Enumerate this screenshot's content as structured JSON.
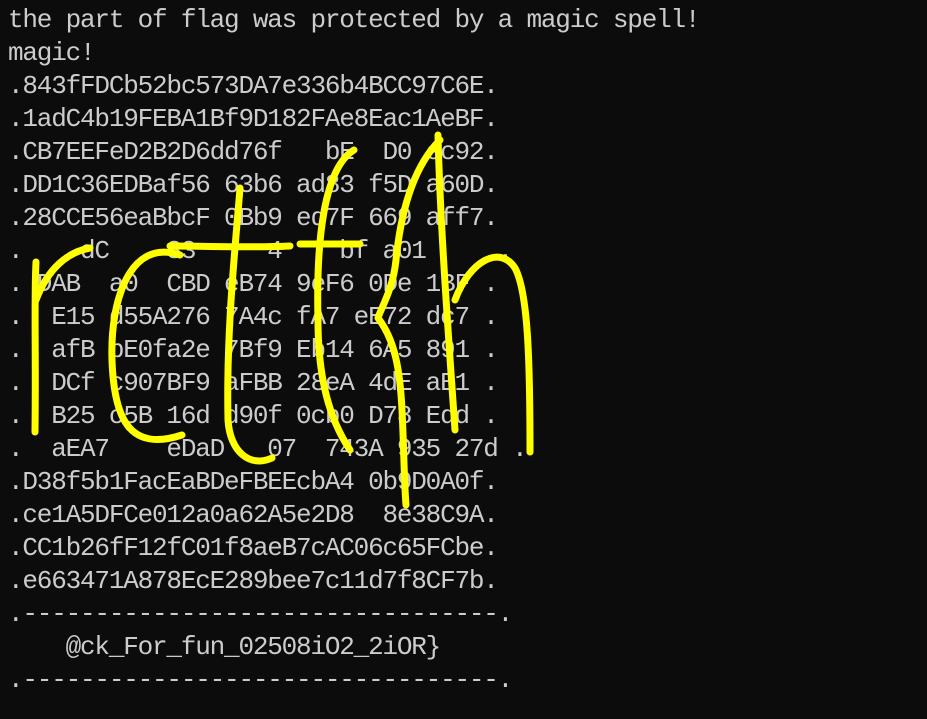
{
  "terminal": {
    "lines": [
      "the part of flag was protected by a magic spell!",
      "magic!",
      ".843fFDCb52bc573DA7e336b4BCC97C6E.",
      ".1adC4b19FEBA1Bf9D182FAe8Eac1AeBF.",
      ".CB7EEFeD2B2D6dd76f   bE  D0 ec92.",
      ".DD1C36EDBaf56 63b6 ad83 f5D a60D.",
      ".28CCE56eaBbcF 0Bb9 ed7F 669 aff7.",
      ".    dC    83     4    bf a01     .",
      ". DAB  a0  CBD eB74 9eF6 0De 1BF .",
      ".  E15 d55A276 7A4c fA7 eE72 dc7 .",
      ".  afB bE0fa2e 7Bf9 Eb14 6A5 891 .",
      ".  DCf c907BF9 aFBB 28eA 4dE aB1 .",
      ".  B25 c5B 16d d90f 0cb0 D78 Edd .",
      ".  aEA7    eDaD   07  743A 935 27d .",
      ".D38f5b1FacEaBDeFBEEcbA4 0b9D0A0f.",
      ".ce1A5DFCe012a0a62A5e2D8  8e38C9A.",
      ".CC1b26fF12fC01f8aeB7cAC06c65FCbe.",
      ".e663471A878EcE289bee7c11d7f8CF7b.",
      ".---------------------------------.",
      "    @ck_For_fun_02508iO2_2iOR}",
      ".---------------------------------."
    ]
  },
  "overlay": {
    "handwritten_text": "rctf{h",
    "color": "#ffff00"
  }
}
